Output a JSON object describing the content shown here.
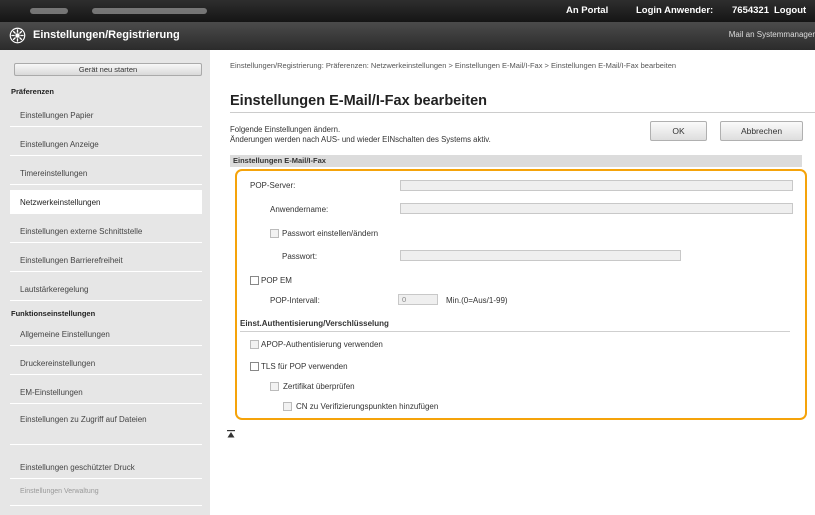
{
  "topbar": {
    "portal": "An Portal",
    "login_label": "Login Anwender:",
    "user_id": "7654321",
    "logout": "Logout"
  },
  "header": {
    "title": "Einstellungen/Registrierung",
    "mail_admin": "Mail an Systemmanager"
  },
  "sidebar": {
    "restart_button": "Gerät neu starten",
    "preferences_heading": "Präferenzen",
    "preferences": [
      "Einstellungen Papier",
      "Einstellungen Anzeige",
      "Timereinstellungen",
      "Netzwerkeinstellungen",
      "Einstellungen externe Schnittstelle",
      "Einstellungen Barrierefreiheit",
      "Lautstärkeregelung"
    ],
    "function_heading": "Funktionseinstellungen",
    "functions": [
      "Allgemeine Einstellungen",
      "Druckereinstellungen",
      "EM-Einstellungen",
      "Einstellungen zu Zugriff auf Dateien",
      "Einstellungen geschützter Druck",
      "Einstellungen Verwaltung"
    ]
  },
  "main": {
    "breadcrumb": "Einstellungen/Registrierung: Präferenzen: Netzwerkeinstellungen > Einstellungen E-Mail/I-Fax > Einstellungen E-Mail/I-Fax bearbeiten",
    "page_title": "Einstellungen E-Mail/I-Fax bearbeiten",
    "desc_line1": "Folgende Einstellungen ändern.",
    "desc_line2": "Änderungen werden nach AUS- und wieder EINschalten des Systems aktiv.",
    "ok_button": "OK",
    "cancel_button": "Abbrechen",
    "section_title": "Einstellungen E-Mail/I-Fax",
    "pop_server_label": "POP-Server:",
    "pop_server_value": "",
    "username_label": "Anwendername:",
    "username_value": "",
    "set_password_label": "Passwort einstellen/ändern",
    "password_label": "Passwort:",
    "password_value": "",
    "pop_em_label": "POP EM",
    "pop_interval_label": "POP-Intervall:",
    "pop_interval_value": "0",
    "pop_interval_unit": "Min.(0=Aus/1-99)",
    "auth_heading": "Einst.Authentisierung/Verschlüsselung",
    "apop_label": "APOP-Authentisierung verwenden",
    "tls_label": "TLS für POP verwenden",
    "verify_cert_label": "Zertifikat überprüfen",
    "cn_label": "CN zu Verifizierungspunkten hinzufügen"
  },
  "colors": {
    "highlight": "#f5a30a",
    "header_bg": "#2b2b2b",
    "sidebar_bg": "#e6e6e6"
  }
}
